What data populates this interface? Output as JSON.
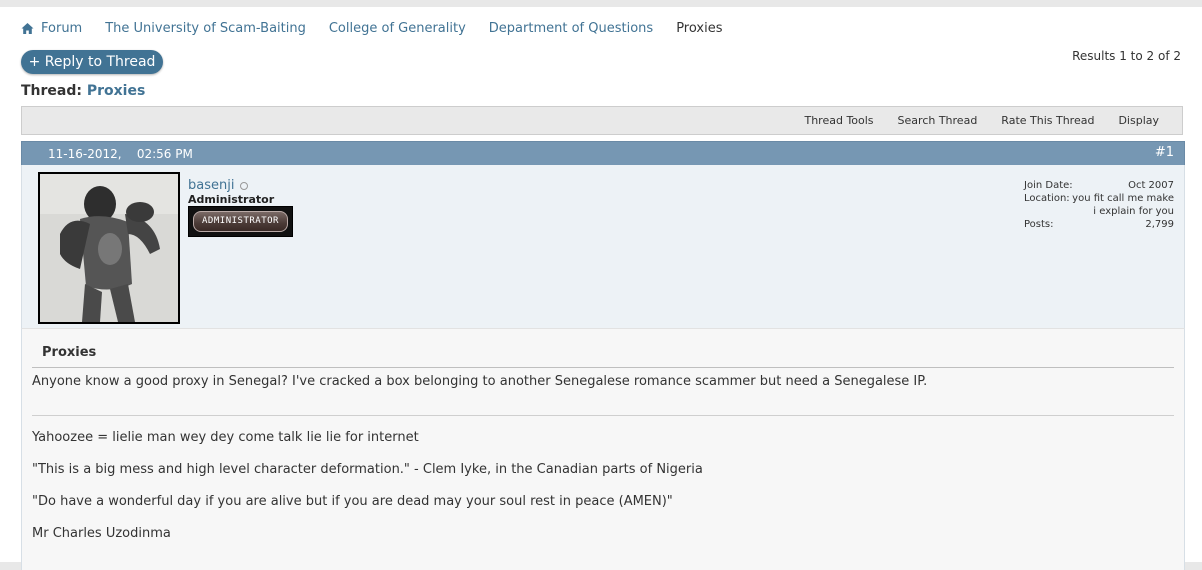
{
  "breadcrumb": {
    "items": [
      "Forum",
      "The University of Scam-Baiting",
      "College of Generality",
      "Department of Questions"
    ],
    "current": "Proxies"
  },
  "toolbar": {
    "reply_label": "+ Reply to Thread",
    "results": "Results 1 to 2 of 2"
  },
  "thread": {
    "prefix": "Thread:",
    "title": "Proxies"
  },
  "thread_tools": [
    "Thread Tools",
    "Search Thread",
    "Rate This Thread",
    "Display"
  ],
  "post": {
    "date": "11-16-2012,",
    "time": "02:56 PM",
    "number": "#1",
    "username": "basenji",
    "user_title": "Administrator",
    "rank_badge": "ADMINISTRATOR",
    "join_date_label": "Join Date:",
    "join_date": "Oct 2007",
    "location_label": "Location:",
    "location_line1": "you fit call me make",
    "location_line2": "i explain for you",
    "posts_label": "Posts:",
    "posts": "2,799",
    "title": "Proxies",
    "message": "Anyone know a good proxy in Senegal? I've cracked a box belonging to another Senegalese romance scammer but need a Senegalese IP.",
    "signature": [
      "Yahoozee = lielie man wey dey come talk lie lie for internet",
      "\"This is a big mess and high level character deformation.\" - Clem Iyke, in the Canadian parts of Nigeria",
      "\"Do have a wonderful day if you are alive but if you are dead may your soul rest in peace (AMEN)\"",
      "Mr Charles Uzodinma"
    ]
  },
  "colors": {
    "link": "#417394",
    "post_header": "#7697b3",
    "userinfo_bg": "#edf2f6"
  }
}
